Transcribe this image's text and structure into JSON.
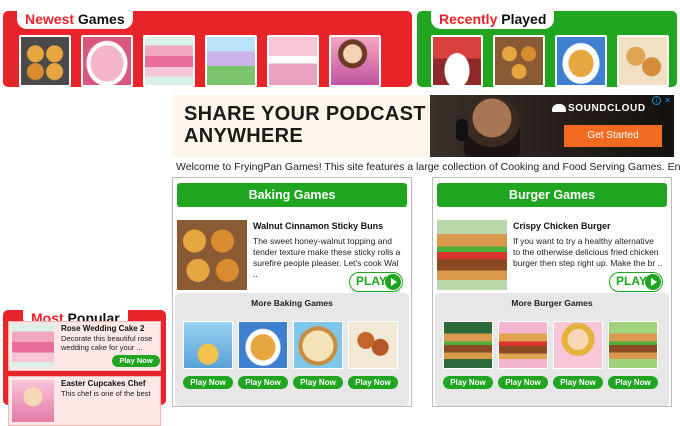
{
  "newest": {
    "title_highlight": "Newest",
    "title_rest": " Games",
    "color": "#e8242b",
    "thumbs": [
      "donuts-thumb",
      "cake-thumb",
      "rose-cake-thumb",
      "castle-cake-thumb",
      "pastry-shop-thumb",
      "girl-chef-thumb"
    ]
  },
  "recent": {
    "title_highlight": "Recently",
    "title_rest": " Played",
    "color": "#1fa51f",
    "thumbs": [
      "mixer-thumb",
      "sticky-buns-thumb",
      "donut-plate-thumb",
      "cinnamon-thumb"
    ]
  },
  "ad": {
    "headline_line1": "SHARE YOUR PODCAST",
    "headline_line2": "ANYWHERE",
    "brand": "SOUNDCLOUD",
    "cta": "Get Started",
    "close": "✕",
    "info": "i"
  },
  "welcome": "Welcome to FryingPan Games! This site features a large collection of Cooking and Food Serving Games. Enjoy!",
  "baking": {
    "header": "Baking Games",
    "featured_title": "Walnut Cinnamon Sticky Buns",
    "featured_desc": "The sweet honey-walnut topping and tender texture make these sticky rolls a surefire people pleaser. Let's cook Wal ..",
    "play": "PLAY",
    "more_title": "More Baking Games",
    "play_now": "Play Now"
  },
  "burger": {
    "header": "Burger Games",
    "featured_title": "Crispy Chicken Burger",
    "featured_desc": "If you want to try a healthy alternative to the otherwise delicious fried chicken burger then step right up. Make the br ..",
    "play": "PLAY",
    "more_title": "More Burger Games",
    "play_now": "Play Now"
  },
  "popular": {
    "title_highlight": "Most",
    "title_rest": " Popular",
    "items": [
      {
        "name": "Rose Wedding Cake 2",
        "desc": "Decorate this beautiful rose wedding cake for your ...",
        "button": "Play Now"
      },
      {
        "name": "Easter Cupcakes Chef",
        "desc": "This chef is one of the best",
        "button": "Play Now"
      }
    ]
  }
}
